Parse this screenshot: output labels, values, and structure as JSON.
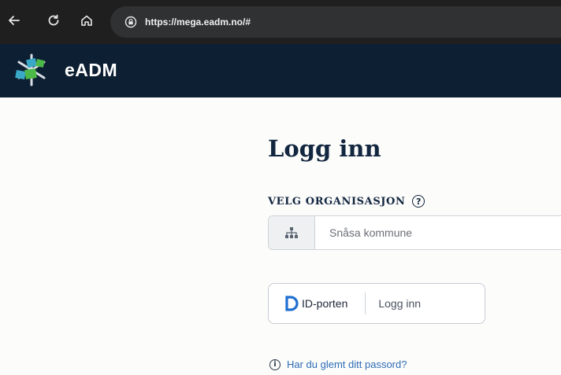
{
  "browser": {
    "url": "https://mega.eadm.no/#",
    "icons": [
      "back-arrow-icon",
      "reload-icon",
      "home-icon",
      "site-info-icon"
    ]
  },
  "header": {
    "brand": "eADM",
    "logo_colors": [
      "#3aa9c7",
      "#4cb848",
      "#d6dde6"
    ]
  },
  "login": {
    "title": "Logg inn",
    "org_label": "VELG ORGANISASJON",
    "org_help_glyph": "?",
    "org_value": "Snåsa kommune",
    "idporten_label": "ID-porten",
    "login_label": "Logg inn",
    "forgot_glyph": "i",
    "forgot_password": "Har du glemt ditt passord?"
  },
  "colors": {
    "header_bg": "#0d1f33",
    "title": "#12263f",
    "link": "#2d6cb5",
    "idporten_blue": "#1f6fd1"
  }
}
